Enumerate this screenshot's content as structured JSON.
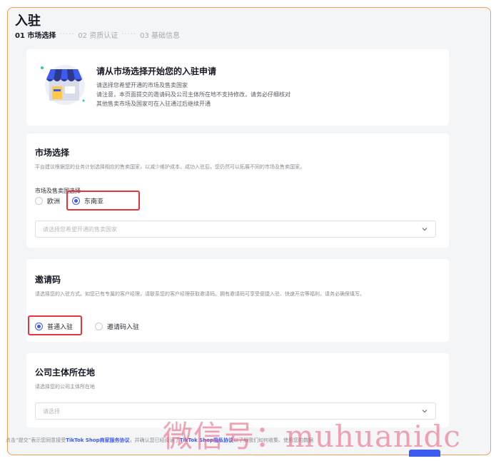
{
  "page": {
    "title": "入驻"
  },
  "steps": [
    {
      "label": "01 市场选择",
      "active": true
    },
    {
      "label": "02 资质认证",
      "active": false
    },
    {
      "label": "03 基础信息",
      "active": false
    }
  ],
  "steps_separator": "·····",
  "intro": {
    "heading": "请从市场选择开始您的入驻申请",
    "lines": [
      "请选择您希望开通的市场及售卖国家",
      "请注意，本页面提交的邀请码及公司主体所在地不支持修改，请务必仔细核对",
      "其他售卖市场及国家可在入驻通过后继续开通"
    ]
  },
  "market": {
    "title": "市场选择",
    "description": "平台建议根据您的业务计划选择相应的售卖国家，以减少维护成本，成功入驻后，您仍然可以拓展不同的市场及售卖国家。",
    "field_label": "市场及售卖国选择",
    "options": [
      {
        "label": "欧洲",
        "checked": false
      },
      {
        "label": "东南亚",
        "checked": true
      }
    ],
    "country_placeholder": "请选择您希望开通的售卖国家"
  },
  "invite": {
    "title": "邀请码",
    "description": "请选择您的入驻方式。如您已有专属的客户经理，请联系您的客户经理获取邀请码。拥有邀请码可享受便捷入驻、快速开店等福利，请务必确保填写。",
    "options": [
      {
        "label": "普通入驻",
        "checked": true
      },
      {
        "label": "邀请码入驻",
        "checked": false
      }
    ]
  },
  "company": {
    "title": "公司主体所在地",
    "description": "请选择您的公司主体所在地",
    "placeholder": "请选择"
  },
  "footer": {
    "prefix": "点击“提交”表示您同意接受",
    "link1": "TikTok Shop商家服务协议",
    "middle": "，并确认您已经阅读了",
    "link2": "TikTok Shop隐私协议",
    "suffix": "以了解我们如何收集、使用您的数据"
  },
  "watermark": "微信号：muhuanidc",
  "colors": {
    "accent": "#3d5af1",
    "highlight": "#e5343b",
    "frame": "#e8a25a"
  }
}
